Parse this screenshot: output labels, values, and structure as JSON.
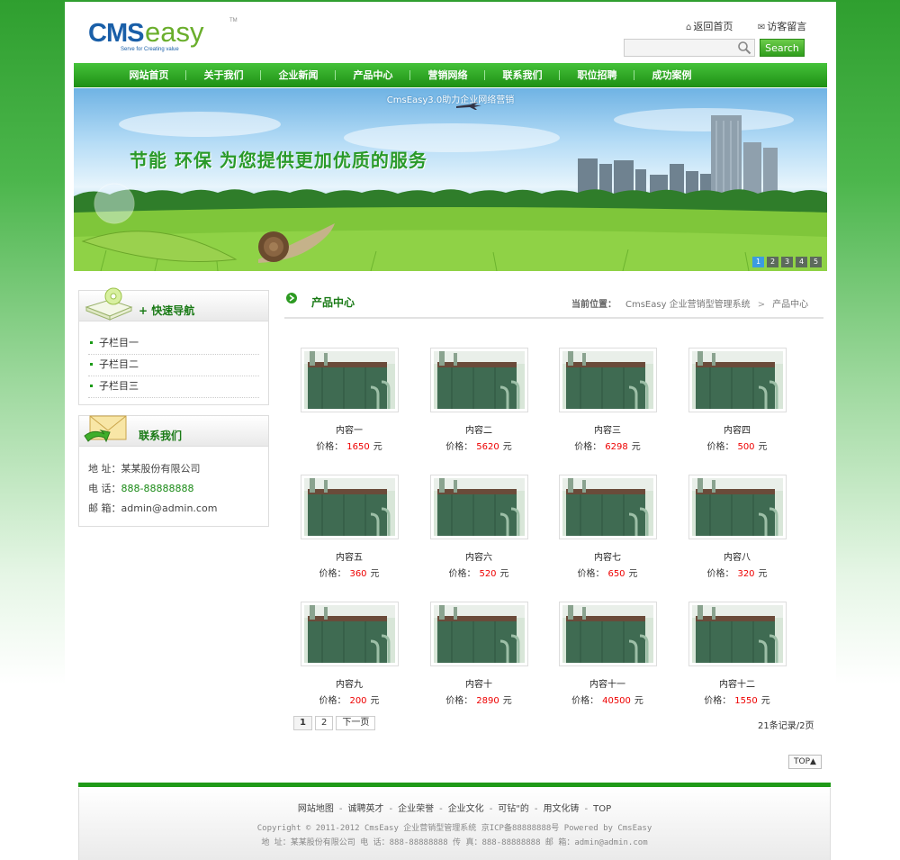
{
  "header": {
    "logo_text": "CMSeasy",
    "logo_tagline": "Serve for Creating value",
    "logo_tm": "TM",
    "home_link": "返回首页",
    "guestbook_link": "访客留言",
    "search_placeholder": "",
    "search_button": "Search"
  },
  "nav": {
    "items": [
      "网站首页",
      "关于我们",
      "企业新闻",
      "产品中心",
      "营销网络",
      "联系我们",
      "职位招聘",
      "成功案例"
    ]
  },
  "banner": {
    "caption": "CmsEasy3.0助力企业网络营销",
    "slogan": "节能  环保  为您提供更加优质的服务",
    "slides": [
      "1",
      "2",
      "3",
      "4",
      "5"
    ],
    "active_slide": 1
  },
  "sidebar": {
    "quick_nav": {
      "title": "+ 快速导航",
      "items": [
        "子栏目一",
        "子栏目二",
        "子栏目三"
      ]
    },
    "contact": {
      "title": "联系我们",
      "address": "地 址：某某股份有限公司",
      "phone_label": "电 话：",
      "phone": "888-88888888",
      "email": "邮 箱：admin@admin.com"
    }
  },
  "main": {
    "title": "产品中心",
    "breadcrumb_label": "当前位置：",
    "breadcrumb": [
      "CmsEasy 企业营销型管理系统",
      "产品中心"
    ],
    "breadcrumb_sep": ">",
    "price_label": "价格：",
    "price_unit": "元",
    "products": [
      {
        "name": "内容一",
        "price": "1650"
      },
      {
        "name": "内容二",
        "price": "5620"
      },
      {
        "name": "内容三",
        "price": "6298"
      },
      {
        "name": "内容四",
        "price": "500"
      },
      {
        "name": "内容五",
        "price": "360"
      },
      {
        "name": "内容六",
        "price": "520"
      },
      {
        "name": "内容七",
        "price": "650"
      },
      {
        "name": "内容八",
        "price": "320"
      },
      {
        "name": "内容九",
        "price": "200"
      },
      {
        "name": "内容十",
        "price": "2890"
      },
      {
        "name": "内容十一",
        "price": "40500"
      },
      {
        "name": "内容十二",
        "price": "1550"
      }
    ],
    "pager": {
      "pages": [
        "1",
        "2"
      ],
      "current": "1",
      "next": "下一页"
    },
    "records": "21条记录/2页",
    "top_button": "TOP▲"
  },
  "footer": {
    "links": [
      "网站地图",
      "诚聘英才",
      "企业荣誉",
      "企业文化",
      "可钻\"的",
      "用文化铸",
      "TOP"
    ],
    "link_sep": "-",
    "copyright": "Copyright © 2011-2012  CmsEasy 企业营销型管理系统  京ICP备88888888号  Powered by CmsEasy",
    "address": "地 址：某某股份有限公司  电 话：888-88888888  传 真：888-88888888  邮 箱：admin@admin.com"
  },
  "colors": {
    "brand_green": "#1f9a18",
    "price_red": "#e00000",
    "logo_blue": "#1a5fa8",
    "logo_green": "#6aae2c"
  }
}
